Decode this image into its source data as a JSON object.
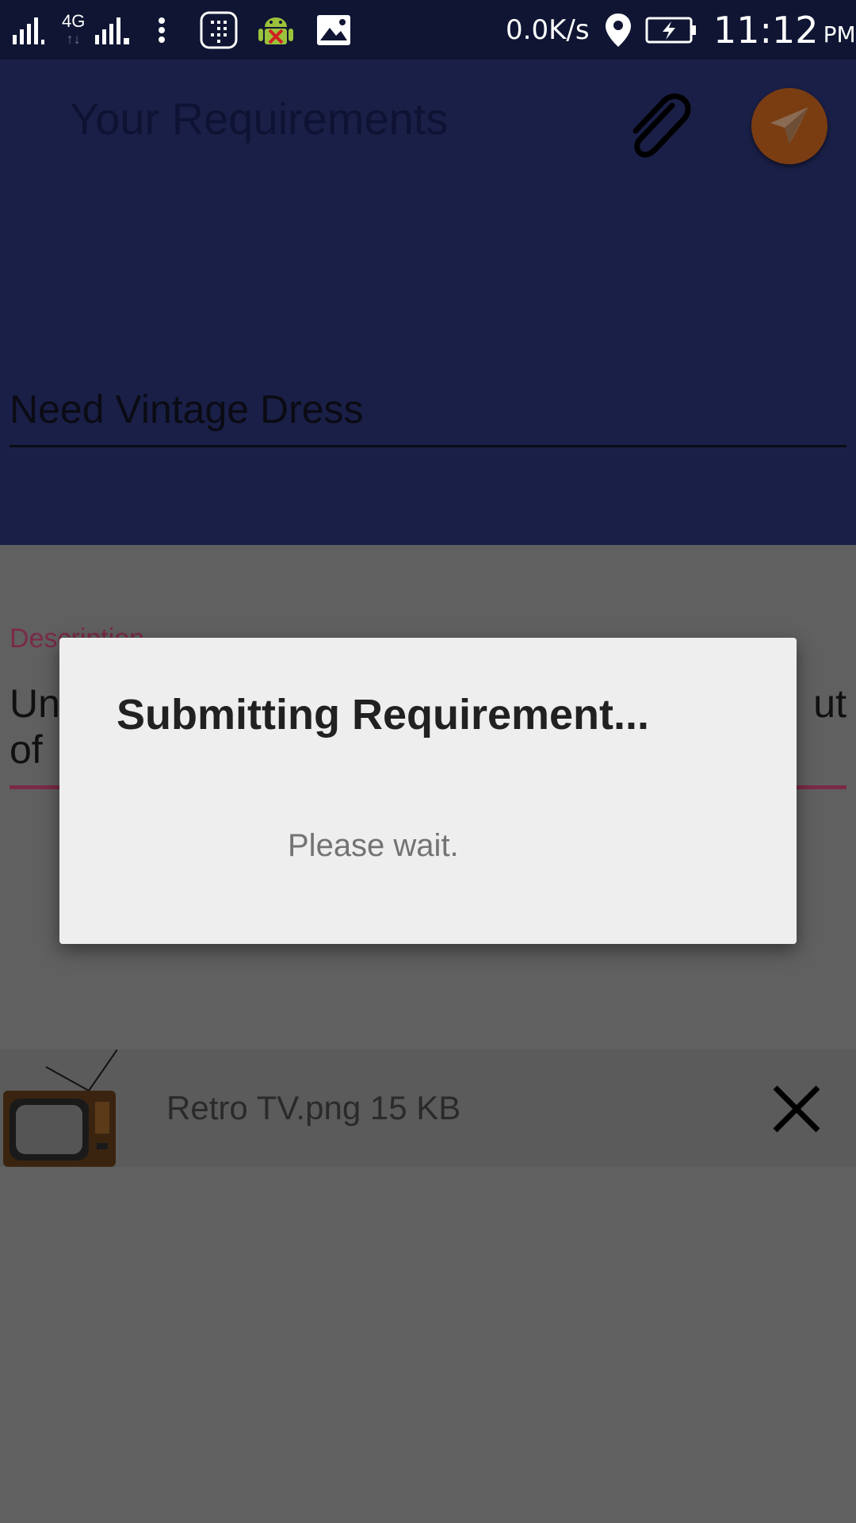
{
  "status_bar": {
    "network_type": "4G",
    "net_speed": "0.0K/s",
    "time": "11:12",
    "ampm": "PM",
    "icons": [
      "signal-sim1-icon",
      "signal-sim2-icon",
      "more-icon",
      "app-icon",
      "android-debug-icon",
      "gallery-icon",
      "location-icon",
      "battery-charging-icon"
    ]
  },
  "header": {
    "title": "Your Requirements",
    "attach_icon": "paperclip-icon",
    "send_icon": "send-icon",
    "requirement_title": "Need Vintage Dress"
  },
  "description": {
    "label": "Description",
    "text_visible_start": "Un",
    "text_visible_end": "ut",
    "text_line2": "of"
  },
  "attachment": {
    "file_label": "Retro TV.png 15 KB",
    "thumbnail_icon": "retro-tv-icon",
    "remove_icon": "close-icon"
  },
  "dialog": {
    "title": "Submitting Requirement...",
    "message": "Please wait."
  },
  "colors": {
    "header_bg": "#1a1f47",
    "status_bg": "#0f1533",
    "accent_pink": "#7a2a48",
    "send_button": "#7a3d12",
    "scrim": "#606060",
    "dialog_bg": "#eeeeee"
  }
}
